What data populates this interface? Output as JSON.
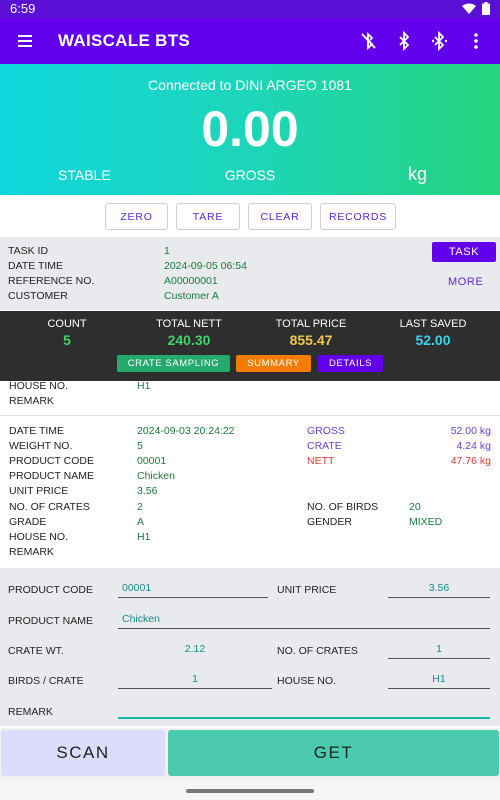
{
  "status_bar": {
    "time": "6:59"
  },
  "app_bar": {
    "title": "WAISCALE BTS"
  },
  "scale": {
    "connection": "Connected to DINI ARGEO 1081",
    "weight": "0.00",
    "state": "STABLE",
    "mode": "GROSS",
    "unit": "kg"
  },
  "actions": {
    "zero": "ZERO",
    "tare": "TARE",
    "clear": "CLEAR",
    "records": "RECORDS"
  },
  "task": {
    "button": "TASK",
    "more": "MORE",
    "rows": [
      {
        "label": "TASK ID",
        "value": "1"
      },
      {
        "label": "DATE TIME",
        "value": "2024-09-05 06:54"
      },
      {
        "label": "REFERENCE NO.",
        "value": "A00000001"
      },
      {
        "label": "CUSTOMER",
        "value": "Customer A"
      }
    ]
  },
  "summary": {
    "count_label": "COUNT",
    "count": "5",
    "nett_label": "TOTAL NETT",
    "nett": "240.30",
    "price_label": "TOTAL PRICE",
    "price": "855.47",
    "saved_label": "LAST SAVED",
    "saved": "52.00",
    "crate_sampling": "CRATE SAMPLING",
    "summary_btn": "SUMMARY",
    "details_btn": "DETAILS"
  },
  "prev_record": {
    "house_label": "HOUSE NO.",
    "house": "H1",
    "remark_label": "REMARK"
  },
  "record": {
    "datetime_label": "DATE TIME",
    "datetime": "2024-09-03 20:24:22",
    "weight_no_label": "WEIGHT NO.",
    "weight_no": "5",
    "product_code_label": "PRODUCT CODE",
    "product_code": "00001",
    "product_name_label": "PRODUCT NAME",
    "product_name": "Chicken",
    "unit_price_label": "UNIT PRICE",
    "unit_price": "3.56",
    "crates_label": "NO. OF CRATES",
    "crates": "2",
    "grade_label": "GRADE",
    "grade": "A",
    "house_label": "HOUSE NO.",
    "house": "H1",
    "remark_label": "REMARK",
    "gross_label": "GROSS",
    "gross": "52.00 kg",
    "crate_label": "CRATE",
    "crate": "4.24 kg",
    "nett_label": "NETT",
    "nett": "47.76 kg",
    "birds_label": "NO. OF BIRDS",
    "birds": "20",
    "gender_label": "GENDER",
    "gender": "MIXED"
  },
  "form": {
    "product_code_label": "PRODUCT CODE",
    "product_code": "00001",
    "unit_price_label": "UNIT PRICE",
    "unit_price": "3.56",
    "product_name_label": "PRODUCT NAME",
    "product_name": "Chicken",
    "crate_wt_label": "CRATE WT.",
    "crate_wt": "2.12",
    "crates_label": "NO. OF CRATES",
    "crates": "1",
    "birds_per_crate_label": "BIRDS / CRATE",
    "birds_per_crate": "1",
    "house_label": "HOUSE NO.",
    "house": "H1",
    "remark_label": "REMARK",
    "remark": ""
  },
  "bottom": {
    "scan": "SCAN",
    "get": "GET"
  },
  "colors": {
    "primary": "#6200ee",
    "accent_green": "#26a96c",
    "accent_orange": "#f57c00",
    "value_green": "#1a7a3a",
    "gross_purple": "#6a3fd6",
    "nett_red": "#e53935",
    "get_teal": "#4ccab0"
  },
  "icons": [
    "menu-icon",
    "bluetooth-disabled-icon",
    "bluetooth-icon",
    "bluetooth-searching-icon",
    "more-vert-icon",
    "wifi-icon",
    "battery-icon"
  ]
}
